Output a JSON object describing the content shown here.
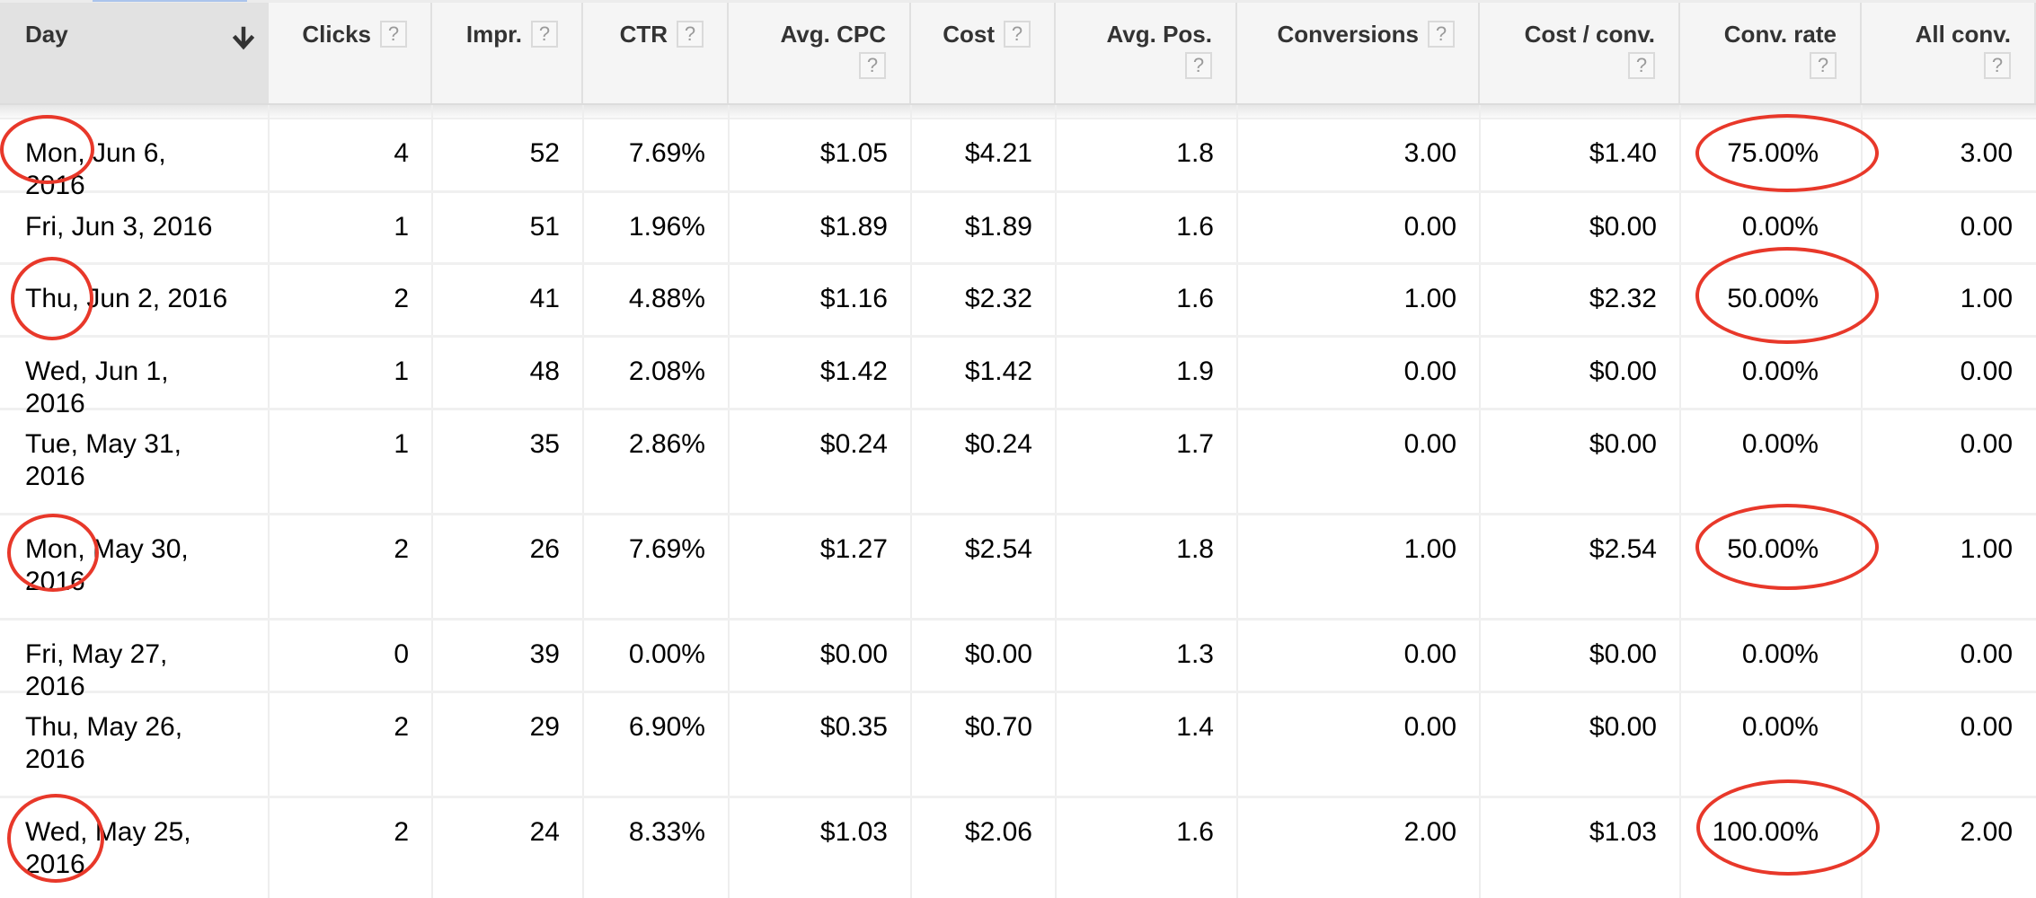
{
  "table": {
    "sort_column": "Day",
    "sort_direction": "descending",
    "columns": [
      {
        "key": "day",
        "label": "Day",
        "help": false
      },
      {
        "key": "clicks",
        "label": "Clicks",
        "help": true
      },
      {
        "key": "impr",
        "label": "Impr.",
        "help": true
      },
      {
        "key": "ctr",
        "label": "CTR",
        "help": true
      },
      {
        "key": "avg_cpc",
        "label": "Avg. CPC",
        "help": true
      },
      {
        "key": "cost",
        "label": "Cost",
        "help": true
      },
      {
        "key": "avg_pos",
        "label": "Avg. Pos.",
        "help": true
      },
      {
        "key": "conversions",
        "label": "Conversions",
        "help": true
      },
      {
        "key": "cost_per_conv",
        "label": "Cost / conv.",
        "help": true
      },
      {
        "key": "conv_rate",
        "label": "Conv. rate",
        "help": true
      },
      {
        "key": "all_conv",
        "label": "All conv.",
        "help": true
      }
    ],
    "help_glyph": "?",
    "rows": [
      {
        "day": "Mon, Jun 6, 2016",
        "clicks": "4",
        "impr": "52",
        "ctr": "7.69%",
        "avg_cpc": "$1.05",
        "cost": "$4.21",
        "avg_pos": "1.8",
        "conversions": "3.00",
        "cost_per_conv": "$1.40",
        "conv_rate": "75.00%",
        "all_conv": "3.00",
        "highlighted": true
      },
      {
        "day": "Fri, Jun 3, 2016",
        "clicks": "1",
        "impr": "51",
        "ctr": "1.96%",
        "avg_cpc": "$1.89",
        "cost": "$1.89",
        "avg_pos": "1.6",
        "conversions": "0.00",
        "cost_per_conv": "$0.00",
        "conv_rate": "0.00%",
        "all_conv": "0.00",
        "highlighted": false
      },
      {
        "day": "Thu, Jun 2, 2016",
        "clicks": "2",
        "impr": "41",
        "ctr": "4.88%",
        "avg_cpc": "$1.16",
        "cost": "$2.32",
        "avg_pos": "1.6",
        "conversions": "1.00",
        "cost_per_conv": "$2.32",
        "conv_rate": "50.00%",
        "all_conv": "1.00",
        "highlighted": true
      },
      {
        "day": "Wed, Jun 1, 2016",
        "clicks": "1",
        "impr": "48",
        "ctr": "2.08%",
        "avg_cpc": "$1.42",
        "cost": "$1.42",
        "avg_pos": "1.9",
        "conversions": "0.00",
        "cost_per_conv": "$0.00",
        "conv_rate": "0.00%",
        "all_conv": "0.00",
        "highlighted": false
      },
      {
        "day": "Tue, May 31, 2016",
        "clicks": "1",
        "impr": "35",
        "ctr": "2.86%",
        "avg_cpc": "$0.24",
        "cost": "$0.24",
        "avg_pos": "1.7",
        "conversions": "0.00",
        "cost_per_conv": "$0.00",
        "conv_rate": "0.00%",
        "all_conv": "0.00",
        "highlighted": false
      },
      {
        "day": "Mon, May 30, 2016",
        "clicks": "2",
        "impr": "26",
        "ctr": "7.69%",
        "avg_cpc": "$1.27",
        "cost": "$2.54",
        "avg_pos": "1.8",
        "conversions": "1.00",
        "cost_per_conv": "$2.54",
        "conv_rate": "50.00%",
        "all_conv": "1.00",
        "highlighted": true
      },
      {
        "day": "Fri, May 27, 2016",
        "clicks": "0",
        "impr": "39",
        "ctr": "0.00%",
        "avg_cpc": "$0.00",
        "cost": "$0.00",
        "avg_pos": "1.3",
        "conversions": "0.00",
        "cost_per_conv": "$0.00",
        "conv_rate": "0.00%",
        "all_conv": "0.00",
        "highlighted": false
      },
      {
        "day": "Thu, May 26, 2016",
        "clicks": "2",
        "impr": "29",
        "ctr": "6.90%",
        "avg_cpc": "$0.35",
        "cost": "$0.70",
        "avg_pos": "1.4",
        "conversions": "0.00",
        "cost_per_conv": "$0.00",
        "conv_rate": "0.00%",
        "all_conv": "0.00",
        "highlighted": false
      },
      {
        "day": "Wed, May 25, 2016",
        "clicks": "2",
        "impr": "24",
        "ctr": "8.33%",
        "avg_cpc": "$1.03",
        "cost": "$2.06",
        "avg_pos": "1.6",
        "conversions": "2.00",
        "cost_per_conv": "$1.03",
        "conv_rate": "100.00%",
        "all_conv": "2.00",
        "highlighted": true
      }
    ]
  },
  "annotations": {
    "color": "#e8382a",
    "circled_day_rows": [
      0,
      2,
      5,
      8
    ],
    "circled_conv_rate_rows": [
      0,
      2,
      5,
      8
    ]
  }
}
